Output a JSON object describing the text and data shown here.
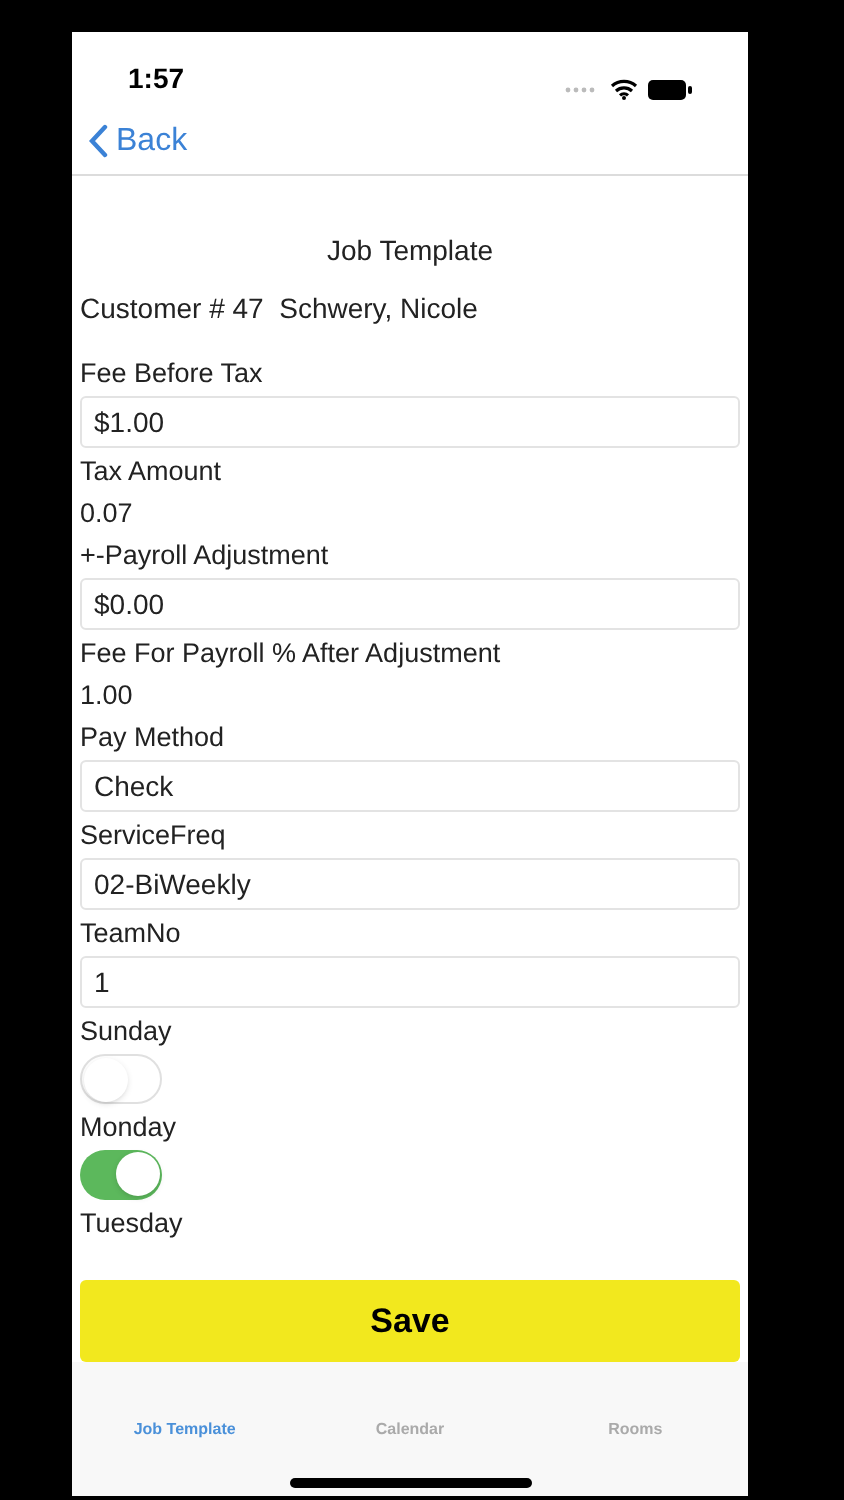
{
  "status_bar": {
    "time": "1:57"
  },
  "nav": {
    "back": "Back"
  },
  "title": "Job Template",
  "customer": "Customer # 47  Schwery, Nicole",
  "fields": [
    {
      "kind": "label",
      "text": "Fee Before Tax"
    },
    {
      "kind": "input",
      "value": "$1.00"
    },
    {
      "kind": "label",
      "text": "Tax Amount"
    },
    {
      "kind": "value",
      "text": "0.07"
    },
    {
      "kind": "label",
      "text": "+-Payroll Adjustment"
    },
    {
      "kind": "input",
      "value": "$0.00"
    },
    {
      "kind": "label",
      "text": "Fee For Payroll % After Adjustment"
    },
    {
      "kind": "value",
      "text": "1.00"
    },
    {
      "kind": "label",
      "text": "Pay Method"
    },
    {
      "kind": "input",
      "value": "Check"
    },
    {
      "kind": "label",
      "text": "ServiceFreq"
    },
    {
      "kind": "input",
      "value": "02-BiWeekly"
    },
    {
      "kind": "label",
      "text": "TeamNo"
    },
    {
      "kind": "input",
      "value": "1"
    },
    {
      "kind": "label",
      "text": "Sunday"
    },
    {
      "kind": "toggle",
      "on": false
    },
    {
      "kind": "label",
      "text": "Monday"
    },
    {
      "kind": "toggle",
      "on": true
    },
    {
      "kind": "label",
      "text": "Tuesday"
    }
  ],
  "save_button": "Save",
  "tabs": [
    {
      "label": "Job Template",
      "selected": true
    },
    {
      "label": "Calendar",
      "selected": false
    },
    {
      "label": "Rooms",
      "selected": false
    }
  ]
}
